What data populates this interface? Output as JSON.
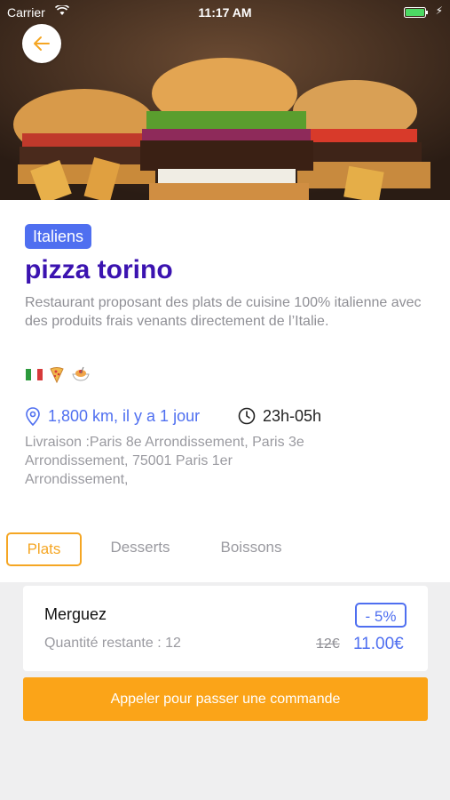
{
  "status_bar": {
    "carrier": "Carrier",
    "time": "11:17 AM"
  },
  "header": {
    "back_icon": "arrow-left-icon",
    "hero_image": "burgers-photo"
  },
  "restaurant": {
    "category": "Italiens",
    "name": "pizza torino",
    "description": "Restaurant proposant des plats de cuisine 100% italienne avec des produits frais venants directement de l’Italie.",
    "tags": [
      "italian-flag-icon",
      "pizza-icon",
      "spaghetti-icon"
    ],
    "distance": "1,800 km, il y a 1 jour",
    "hours": "23h-05h",
    "address": "Livraison :Paris 8e Arrondissement, Paris 3e Arrondissement, 75001 Paris 1er Arrondissement,"
  },
  "tabs": [
    {
      "label": "Plats",
      "active": true
    },
    {
      "label": "Desserts",
      "active": false
    },
    {
      "label": "Boissons",
      "active": false
    }
  ],
  "menu_items": [
    {
      "name": "Merguez",
      "quantity": "Quantité restante : 12",
      "discount": "- 5%",
      "old_price": "12€",
      "new_price": "11.00€"
    }
  ],
  "actions": {
    "call_label": "Appeler pour passer une commande"
  },
  "colors": {
    "accent": "#4f6ff0",
    "title": "#3b13b0",
    "orange": "#fba418"
  }
}
